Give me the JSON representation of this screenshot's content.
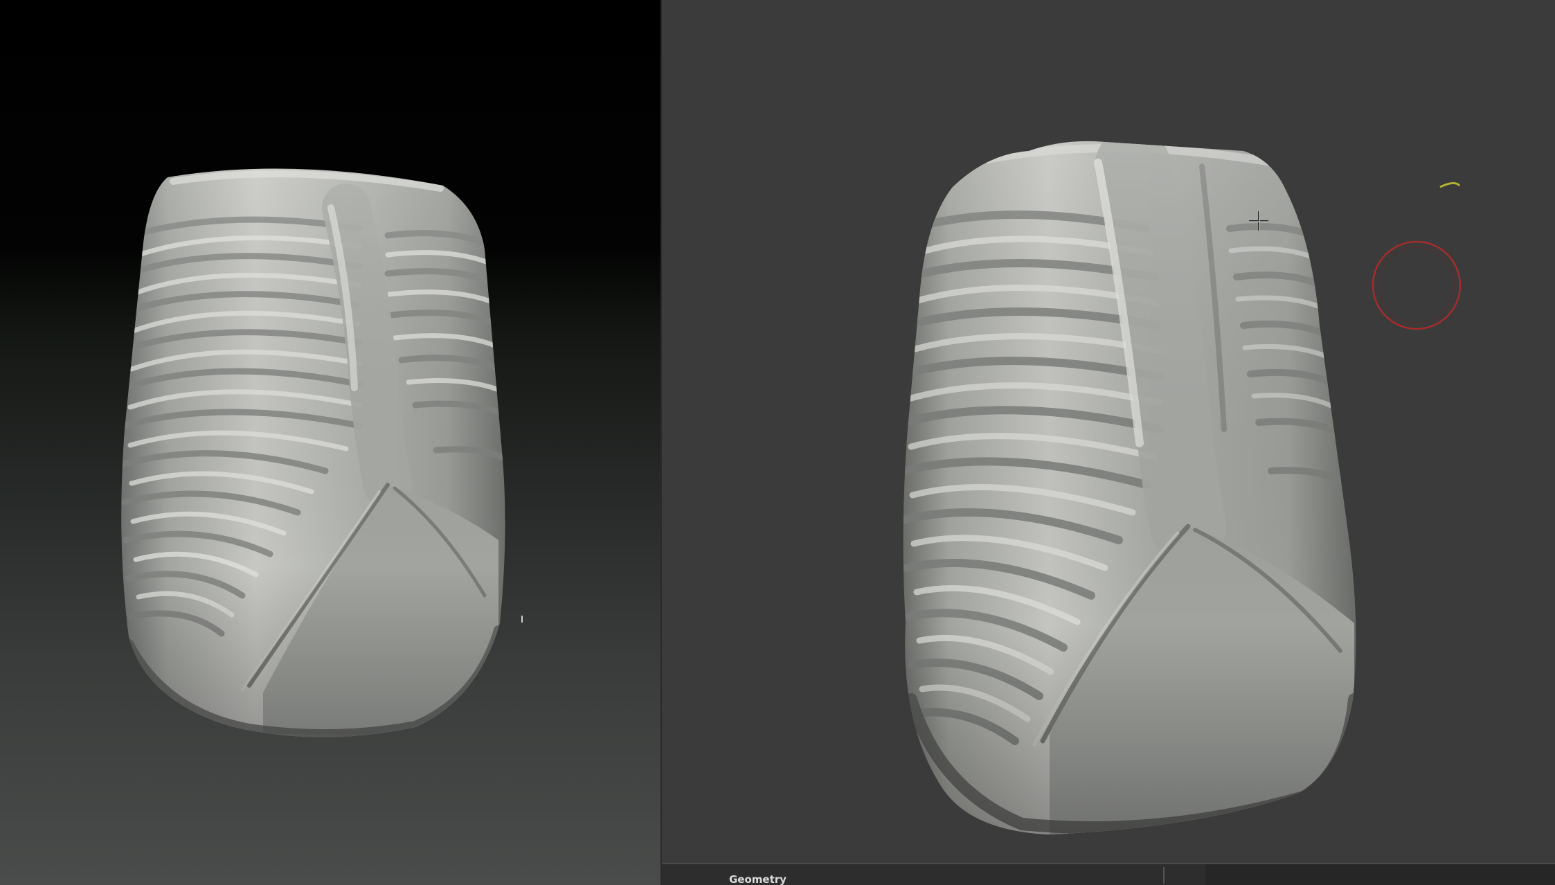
{
  "left_viewport": {
    "model": "low-res-sculpt-mesh"
  },
  "right_viewport": {
    "model": "high-res-sculpt-mesh"
  },
  "bottom_strip": {
    "panel_label": "Geometry"
  },
  "colors": {
    "right_bg": "#3b3b3b",
    "mesh_light": "#d2d3d0",
    "mesh_mid": "#9d9f9b",
    "mesh_dark": "#626461",
    "cursor_ring": "#b22a2a",
    "gizmo_arc": "#b4b432"
  }
}
